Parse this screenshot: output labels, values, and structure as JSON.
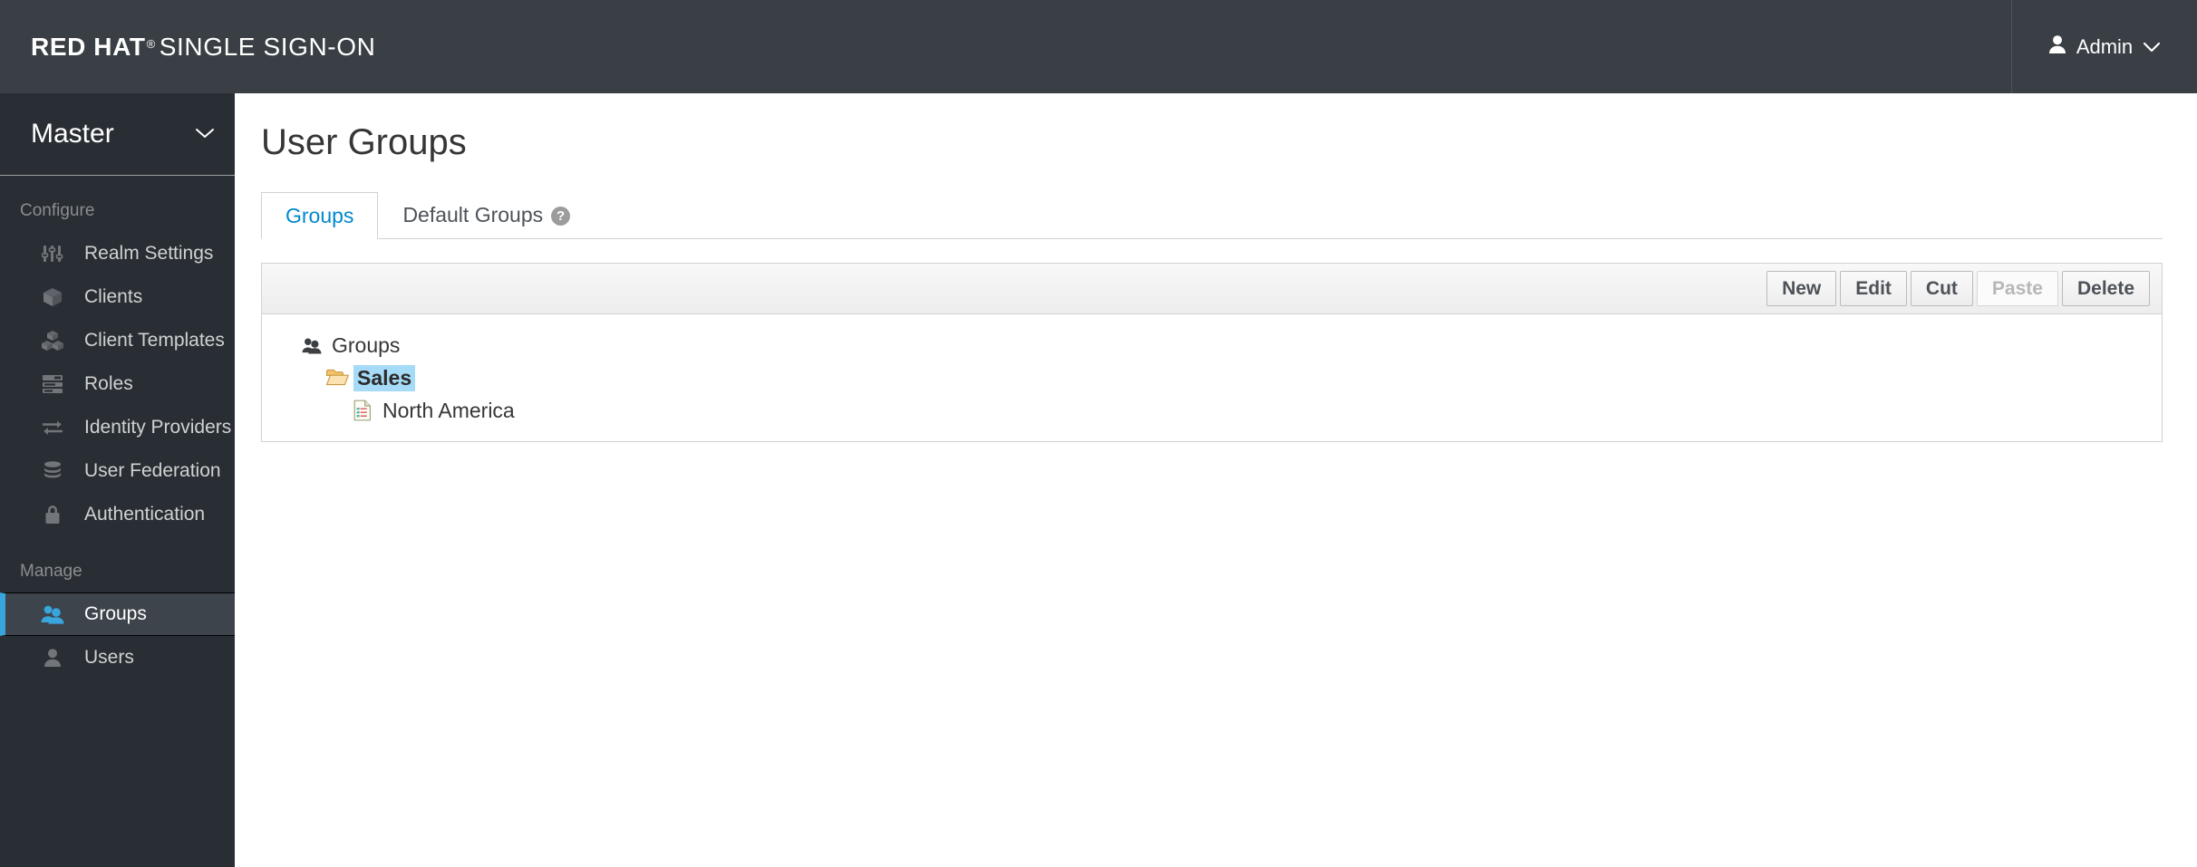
{
  "masthead": {
    "brand_bold": "RED HAT",
    "brand_reg": "®",
    "brand_rest": "SINGLE SIGN-ON",
    "user_label": "Admin",
    "user_icon": "person-icon",
    "caret_icon": "chevron-down-icon",
    "background": "#393f44"
  },
  "sidebar": {
    "realm": {
      "name": "Master",
      "caret_icon": "chevron-down-icon"
    },
    "sections": [
      {
        "title": "Configure",
        "items": [
          {
            "label": "Realm Settings",
            "icon": "sliders-icon",
            "active": false
          },
          {
            "label": "Clients",
            "icon": "cube-icon",
            "active": false
          },
          {
            "label": "Client Templates",
            "icon": "cubes-icon",
            "active": false
          },
          {
            "label": "Roles",
            "icon": "list-server-icon",
            "active": false
          },
          {
            "label": "Identity Providers",
            "icon": "exchange-arrows-icon",
            "active": false
          },
          {
            "label": "User Federation",
            "icon": "database-icon",
            "active": false
          },
          {
            "label": "Authentication",
            "icon": "lock-icon",
            "active": false
          }
        ]
      },
      {
        "title": "Manage",
        "items": [
          {
            "label": "Groups",
            "icon": "users-icon",
            "active": true
          },
          {
            "label": "Users",
            "icon": "user-icon",
            "active": false
          }
        ]
      }
    ],
    "accent_color": "#39a5dc",
    "background": "#292e34"
  },
  "main": {
    "page_title": "User Groups",
    "tabs": [
      {
        "label": "Groups",
        "active": true,
        "help": false
      },
      {
        "label": "Default Groups",
        "active": false,
        "help": true,
        "help_glyph": "?"
      }
    ],
    "toolbar": {
      "buttons": [
        {
          "label": "New",
          "disabled": false
        },
        {
          "label": "Edit",
          "disabled": false
        },
        {
          "label": "Cut",
          "disabled": false
        },
        {
          "label": "Paste",
          "disabled": true
        },
        {
          "label": "Delete",
          "disabled": false
        }
      ]
    },
    "tree": [
      {
        "label": "Groups",
        "icon": "users-icon",
        "level": 0,
        "selected": false
      },
      {
        "label": "Sales",
        "icon": "folder-open-icon",
        "level": 1,
        "selected": true
      },
      {
        "label": "North America",
        "icon": "file-document-icon",
        "level": 2,
        "selected": false
      }
    ],
    "selection_color": "#a6dbf7",
    "tab_active_color": "#0088ce"
  }
}
